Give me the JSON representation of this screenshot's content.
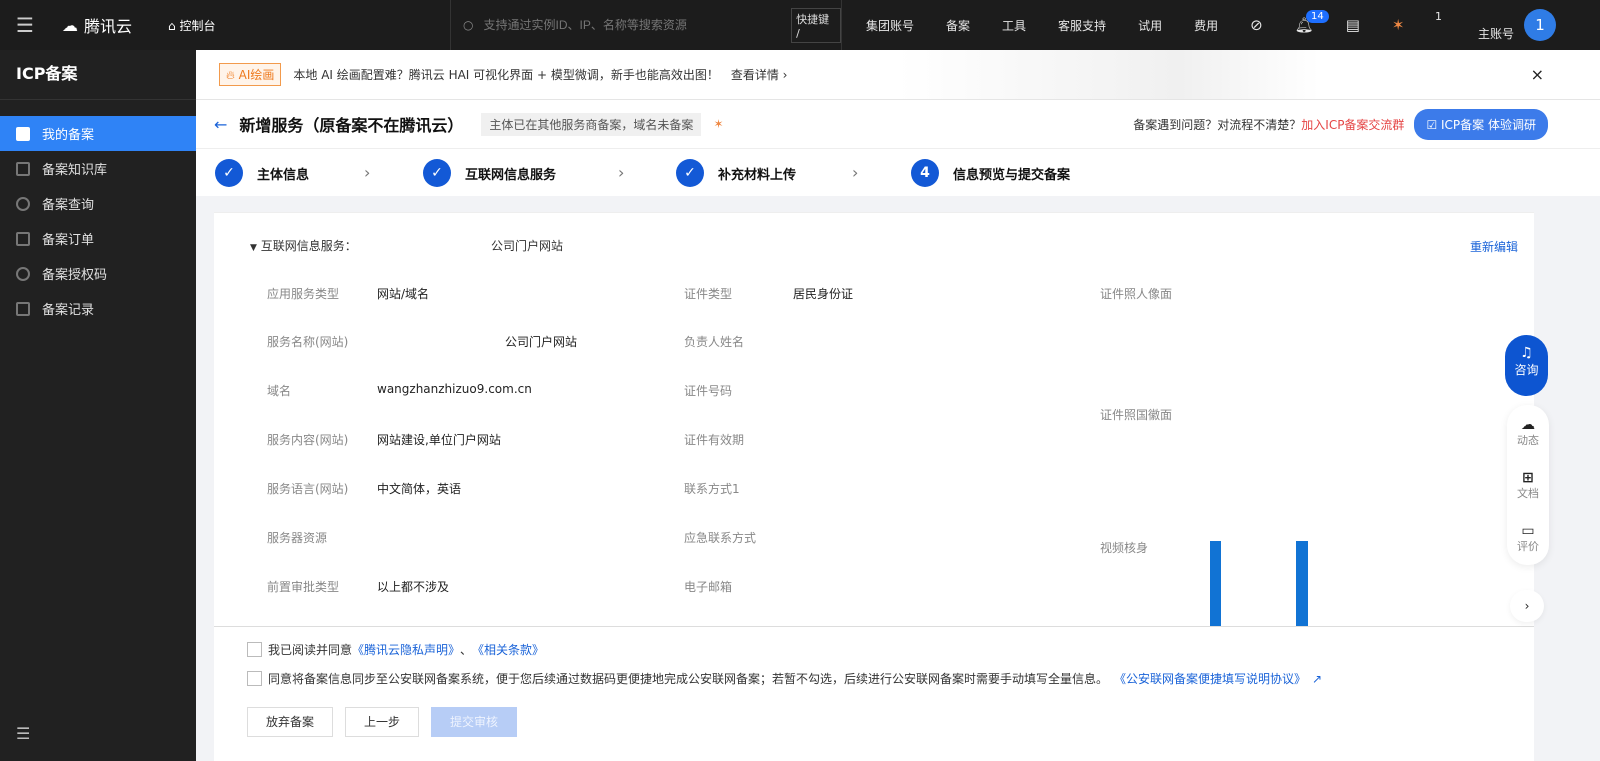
{
  "topbar": {
    "brand": "腾讯云",
    "console": "控制台",
    "search_placeholder": "支持通过实例ID、IP、名称等搜索资源",
    "shortcut": "快捷键 /",
    "nav": [
      "集团账号",
      "备案",
      "工具",
      "客服支持",
      "试用",
      "费用"
    ],
    "notif_count": "14",
    "small_count": "1",
    "account": "主账号",
    "avatar": "1"
  },
  "sidebar": {
    "title": "ICP备案",
    "items": [
      "我的备案",
      "备案知识库",
      "备案查询",
      "备案订单",
      "备案授权码",
      "备案记录"
    ]
  },
  "banner": {
    "tag": "AI绘画",
    "text": "本地 AI 绘画配置难？腾讯云 HAI 可视化界面 + 模型微调，新手也能高效出图！",
    "link": "查看详情 ›",
    "close": "×"
  },
  "header": {
    "back": "←",
    "title": "新增服务（原备案不在腾讯云）",
    "subtitle": "主体已在其他服务商备案，域名未备案",
    "help": "备案遇到问题？对流程不清楚？",
    "help_link": "加入ICP备案交流群",
    "survey_button": "ICP备案  体验调研"
  },
  "steps": [
    {
      "label": "主体信息",
      "mark": "✓"
    },
    {
      "label": "互联网信息服务",
      "mark": "✓"
    },
    {
      "label": "补充材料上传",
      "mark": "✓"
    },
    {
      "label": "信息预览与提交备案",
      "mark": "4"
    }
  ],
  "section": {
    "title": "互联网信息服务：",
    "value": "公司门户网站",
    "edit": "重新编辑"
  },
  "fields_col1": [
    [
      "应用服务类型",
      "网站/域名"
    ],
    [
      "服务名称(网站)",
      "公司门户网站"
    ],
    [
      "域名",
      "wangzhanzhizuo9.com.cn"
    ],
    [
      "服务内容(网站)",
      "网站建设,单位门户网站"
    ],
    [
      "服务语言(网站)",
      "中文简体，英语"
    ],
    [
      "服务器资源",
      ""
    ],
    [
      "前置审批类型",
      "以上都不涉及"
    ]
  ],
  "fields_col2": [
    [
      "证件类型",
      "居民身份证"
    ],
    [
      "负责人姓名",
      ""
    ],
    [
      "证件号码",
      ""
    ],
    [
      "证件有效期",
      ""
    ],
    [
      "联系方式1",
      ""
    ],
    [
      "应急联系方式",
      ""
    ],
    [
      "电子邮箱",
      ""
    ]
  ],
  "fields_col3": [
    "证件照人像面",
    "证件照国徽面",
    "视频核身"
  ],
  "agreements": {
    "a1_prefix": "我已阅读并同意",
    "a1_link1": "《腾讯云隐私声明》",
    "a1_sep": "、",
    "a1_link2": "《相关条款》",
    "a2_text": "同意将备案信息同步至公安联网备案系统，便于您后续通过数据码更便捷地完成公安联网备案；若暂不勾选，后续进行公安联网备案时需要手动填写全量信息。",
    "a2_link": "《公安联网备案便捷填写说明协议》"
  },
  "buttons": {
    "abandon": "放弃备案",
    "prev": "上一步",
    "submit": "提交审核"
  },
  "float": {
    "consult": "咨询",
    "items": [
      "动态",
      "文档",
      "评价"
    ],
    "more": "›"
  }
}
